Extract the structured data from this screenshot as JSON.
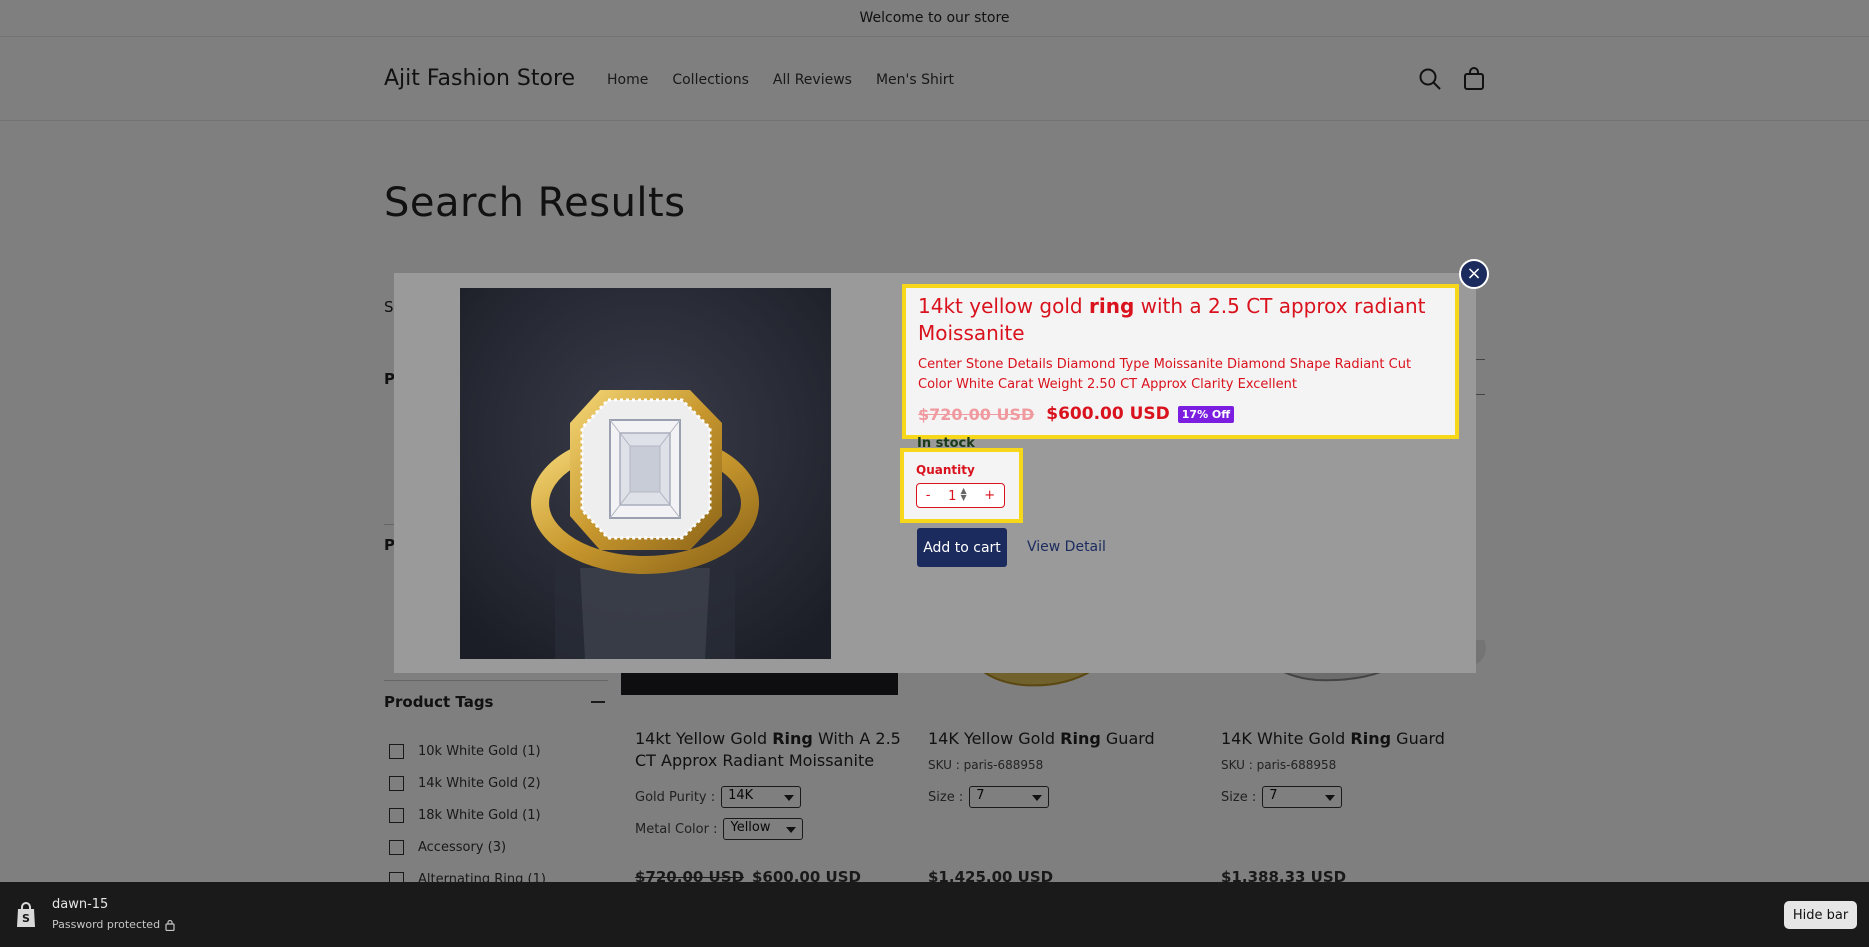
{
  "announcement": "Welcome to our store",
  "header": {
    "logo": "Ajit Fashion Store",
    "nav": [
      "Home",
      "Collections",
      "All Reviews",
      "Men's Shirt"
    ]
  },
  "page": {
    "title": "Search Results"
  },
  "sidebar": {
    "tags_heading": "Product Tags",
    "tags": [
      "10k White Gold (1)",
      "14k White Gold (2)",
      "18k White Gold (1)",
      "Accessory (3)",
      "Alternating Ring (1)"
    ]
  },
  "products": [
    {
      "title_pre": "14kt Yellow Gold ",
      "title_bold": "Ring",
      "title_post": " With A 2.5 CT Approx Radiant Moissanite",
      "opt1_label": "Gold Purity :",
      "opt1_value": "14K",
      "opt2_label": "Metal Color :",
      "opt2_value": "Yellow",
      "compare_price": "$720.00 USD",
      "price": "$600.00 USD"
    },
    {
      "title_pre": "14K Yellow Gold ",
      "title_bold": "Ring",
      "title_post": " Guard",
      "sku": "SKU : paris-688958",
      "opt1_label": "Size :",
      "opt1_value": "7",
      "price": "$1,425.00 USD"
    },
    {
      "title_pre": "14K White Gold ",
      "title_bold": "Ring",
      "title_post": " Guard",
      "sku": "SKU : paris-688958",
      "opt1_label": "Size :",
      "opt1_value": "7",
      "price": "$1,388.33 USD"
    }
  ],
  "modal": {
    "title_pre": "14kt yellow gold ",
    "title_bold": "ring",
    "title_post": " with a 2.5 CT approx radiant Moissanite",
    "description": "Center Stone Details Diamond Type Moissanite Diamond Shape Radiant Cut Color White Carat Weight 2.50 CT Approx Clarity Excellent",
    "compare_price": "$720.00 USD",
    "price": "$600.00 USD",
    "discount_badge": "17% Off",
    "stock": "In stock",
    "quantity_label": "Quantity",
    "quantity_minus": "-",
    "quantity_value": "1",
    "quantity_plus": "+",
    "add_to_cart": "Add to cart",
    "view_detail": "View Detail",
    "close_symbol": "×"
  },
  "preview_bar": {
    "store": "dawn-15",
    "status": "Password protected",
    "hide_button": "Hide bar"
  },
  "colors": {
    "accent_red": "#d9121d",
    "highlight_yellow": "#f7d71a",
    "button_navy": "#1b2b5e",
    "badge_purple": "#7b1ee0"
  },
  "icons": {
    "search": "search-icon",
    "cart": "cart-icon",
    "close": "close-icon",
    "shop": "shopify-bag-icon",
    "lock": "lock-icon"
  }
}
